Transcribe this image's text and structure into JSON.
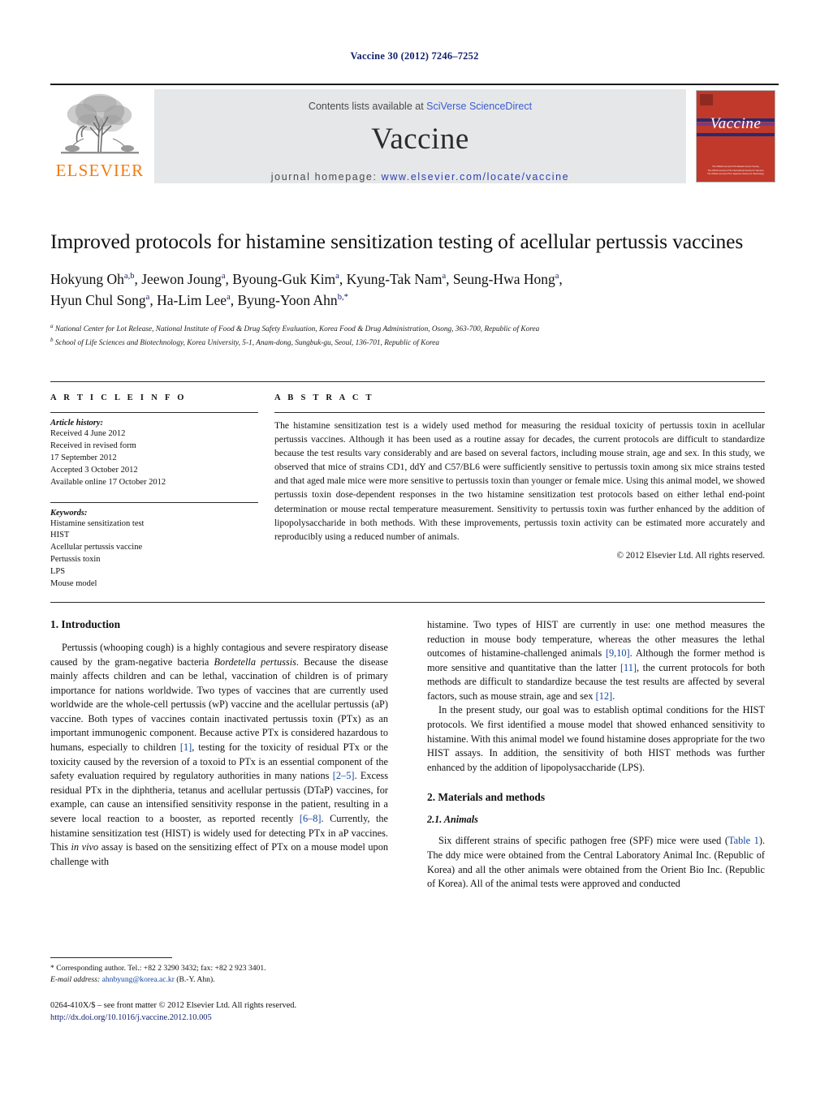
{
  "running_head": "Vaccine 30 (2012) 7246–7252",
  "masthead": {
    "publisher_name": "ELSEVIER",
    "contents_prefix": "Contents lists available at ",
    "contents_link": "SciVerse ScienceDirect",
    "journal_title": "Vaccine",
    "homepage_label": "journal homepage: ",
    "homepage_url": "www.elsevier.com/locate/vaccine",
    "cover_title": "Vaccine",
    "cover_footer_lines": [
      "The Official Journal of The Edward Jenner Society",
      "The Official Journal of The International Society for Vaccines",
      "The Official Journal of The Japanese Society for Vaccinology"
    ],
    "colors": {
      "link_blue": "#3a5ccc",
      "elsevier_orange": "#f07c12",
      "cover_red": "#c0392b",
      "banner_gray": "#e6e7e9"
    }
  },
  "article": {
    "title": "Improved protocols for histamine sensitization testing of acellular pertussis vaccines",
    "authors": [
      {
        "name": "Hokyung Oh",
        "sup": "a,b",
        "sep": ", "
      },
      {
        "name": "Jeewon Joung",
        "sup": "a",
        "sep": ", "
      },
      {
        "name": "Byoung-Guk Kim",
        "sup": "a",
        "sep": ", "
      },
      {
        "name": "Kyung-Tak Nam",
        "sup": "a",
        "sep": ", "
      },
      {
        "name": "Seung-Hwa Hong",
        "sup": "a",
        "sep": ", "
      },
      {
        "name": "Hyun Chul Song",
        "sup": "a",
        "sep": ", "
      },
      {
        "name": "Ha-Lim Lee",
        "sup": "a",
        "sep": ", "
      },
      {
        "name": "Byung-Yoon Ahn",
        "sup": "b,*",
        "sep": ""
      }
    ],
    "affiliations": [
      {
        "mark": "a",
        "text": "National Center for Lot Release, National Institute of Food & Drug Safety Evaluation, Korea Food & Drug Administration, Osong, 363-700, Republic of Korea"
      },
      {
        "mark": "b",
        "text": "School of Life Sciences and Biotechnology, Korea University, 5-1, Anam-dong, Sungbuk-gu, Seoul, 136-701, Republic of Korea"
      }
    ]
  },
  "article_info": {
    "heading": "A R T I C L E    I N F O",
    "history_label": "Article history:",
    "history_lines": [
      "Received 4 June 2012",
      "Received in revised form",
      "17 September 2012",
      "Accepted 3 October 2012",
      "Available online 17 October 2012"
    ],
    "keywords_label": "Keywords:",
    "keywords": [
      "Histamine sensitization test",
      "HIST",
      "Acellular pertussis vaccine",
      "Pertussis toxin",
      "LPS",
      "Mouse model"
    ]
  },
  "abstract": {
    "heading": "A B S T R A C T",
    "text": "The histamine sensitization test is a widely used method for measuring the residual toxicity of pertussis toxin in acellular pertussis vaccines. Although it has been used as a routine assay for decades, the current protocols are difficult to standardize because the test results vary considerably and are based on several factors, including mouse strain, age and sex. In this study, we observed that mice of strains CD1, ddY and C57/BL6 were sufficiently sensitive to pertussis toxin among six mice strains tested and that aged male mice were more sensitive to pertussis toxin than younger or female mice. Using this animal model, we showed pertussis toxin dose-dependent responses in the two histamine sensitization test protocols based on either lethal end-point determination or mouse rectal temperature measurement. Sensitivity to pertussis toxin was further enhanced by the addition of lipopolysaccharide in both methods. With these improvements, pertussis toxin activity can be estimated more accurately and reproducibly using a reduced number of animals.",
    "copyright": "© 2012 Elsevier Ltd. All rights reserved."
  },
  "body": {
    "left": {
      "section_1_heading": "1.  Introduction",
      "para_1a": "Pertussis (whooping cough) is a highly contagious and severe respiratory disease caused by the gram-negative bacteria ",
      "para_1a_italic": "Bordetella pertussis",
      "para_1b": ". Because the disease mainly affects children and can be lethal, vaccination of children is of primary importance for nations worldwide. Two types of vaccines that are currently used worldwide are the whole-cell pertussis (wP) vaccine and the acellular pertussis (aP) vaccine. Both types of vaccines contain inactivated pertussis toxin (PTx) as an important immunogenic component. Because active PTx is considered hazardous to humans, especially to children ",
      "ref_1": "[1]",
      "para_1c": ", testing for the toxicity of residual PTx or the toxicity caused by the reversion of a toxoid to PTx is an essential component of the safety evaluation required by regulatory authorities in many nations ",
      "ref_2": "[2–5]",
      "para_1d": ". Excess residual PTx in the diphtheria, tetanus and acellular pertussis (DTaP) vaccines, for example, can cause an intensified sensitivity response in the patient, resulting in a severe local reaction to a booster, as reported recently ",
      "ref_3": "[6–8]",
      "para_1e": ". Currently, the histamine sensitization test (HIST) is widely used for detecting PTx in aP vaccines. This ",
      "para_1e_italic": "in vivo",
      "para_1f": " assay is based on the sensitizing effect of PTx on a mouse model upon challenge with"
    },
    "right": {
      "para_2a": "histamine. Two types of HIST are currently in use: one method measures the reduction in mouse body temperature, whereas the other measures the lethal outcomes of histamine-challenged animals ",
      "ref_910": "[9,10]",
      "para_2b": ". Although the former method is more sensitive and quantitative than the latter ",
      "ref_11": "[11]",
      "para_2c": ", the current protocols for both methods are difficult to standardize because the test results are affected by several factors, such as mouse strain, age and sex ",
      "ref_12": "[12]",
      "para_2d": ".",
      "para_3": "In the present study, our goal was to establish optimal conditions for the HIST protocols. We first identified a mouse model that showed enhanced sensitivity to histamine. With this animal model we found histamine doses appropriate for the two HIST assays. In addition, the sensitivity of both HIST methods was further enhanced by the addition of lipopolysaccharide (LPS).",
      "section_2_heading": "2.  Materials and methods",
      "subsection_21_heading": "2.1.  Animals",
      "para_4a": "Six different strains of specific pathogen free (SPF) mice were used (",
      "table_link": "Table 1",
      "para_4b": "). The ddy mice were obtained from the Central Laboratory Animal Inc. (Republic of Korea) and all the other animals were obtained from the Orient Bio Inc. (Republic of Korea). All of the animal tests were approved and conducted"
    }
  },
  "footnotes": {
    "corresponding_marker": "*",
    "corresponding_text": " Corresponding author. Tel.: +82 2 3290 3432; fax: +82 2 923 3401.",
    "email_label": "E-mail address:",
    "email": "ahnbyung@korea.ac.kr",
    "email_suffix": " (B.-Y. Ahn).",
    "imprint_line": "0264-410X/$ – see front matter © 2012 Elsevier Ltd. All rights reserved.",
    "doi": "http://dx.doi.org/10.1016/j.vaccine.2012.10.005"
  }
}
